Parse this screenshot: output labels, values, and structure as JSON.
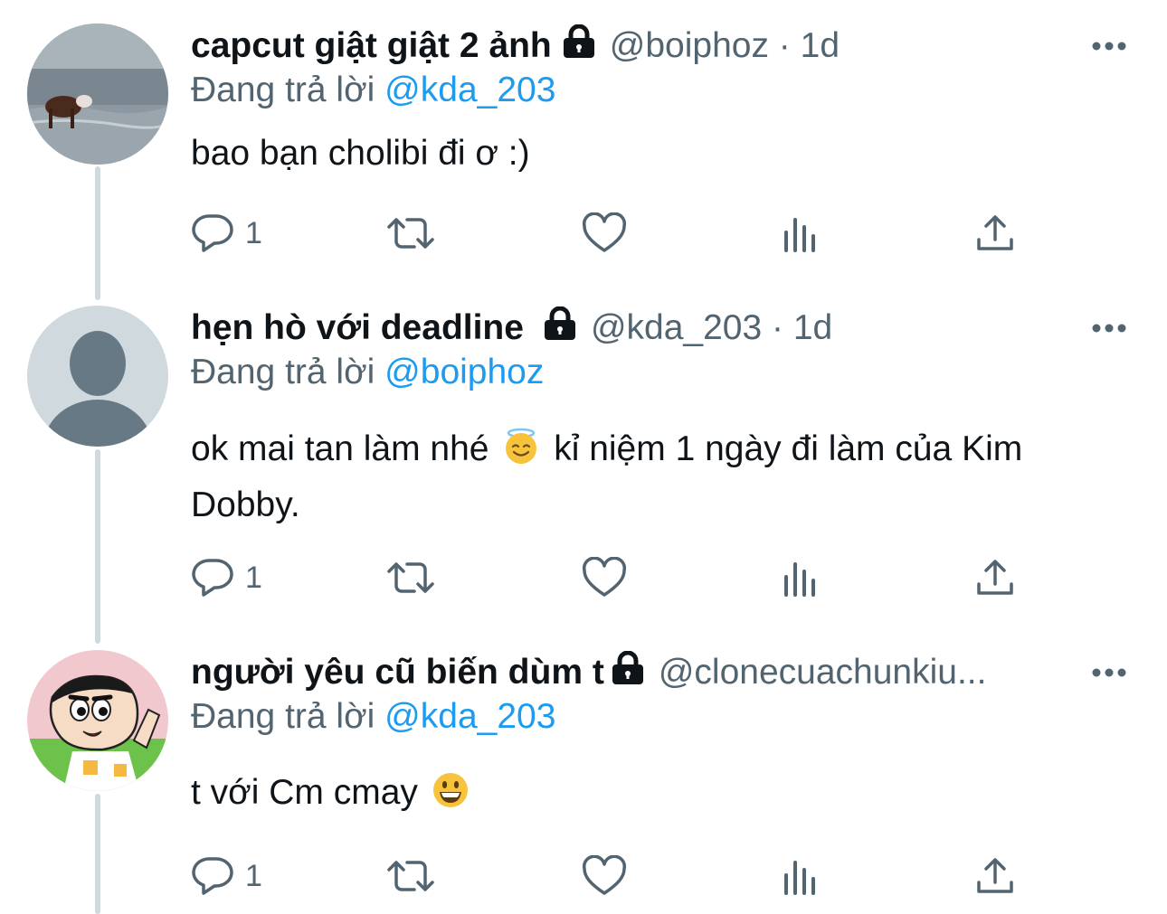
{
  "tweets": [
    {
      "display_name": "capcut giật giật 2 ảnh",
      "handle": "@boiphoz",
      "time": "1d",
      "replying_prefix": "Đang trả lời",
      "replying_to": "@kda_203",
      "text": "bao bạn cholibi đi ơ :)",
      "reply_count": "1",
      "avatar": "cow-on-beach-photo"
    },
    {
      "display_name": "hẹn hò với deadline",
      "handle": "@kda_203",
      "time": "1d",
      "replying_prefix": "Đang trả lời",
      "replying_to": "@boiphoz",
      "text_a": "ok mai tan làm nhé",
      "text_b": "kỉ niệm 1 ngày đi làm của Kim",
      "text_c": "Dobby.",
      "emoji": "smiling-face-with-halo",
      "reply_count": "1",
      "avatar": "default-profile-silhouette"
    },
    {
      "display_name": "người yêu cũ biến dùm t",
      "handle": "@clonecuachunkiu...",
      "replying_prefix": "Đang trả lời",
      "replying_to": "@kda_203",
      "text": "t với Cm cmay",
      "emoji": "grinning-face",
      "reply_count": "1",
      "avatar": "cartoon-boy-avatar"
    }
  ],
  "icons": [
    "lock-icon",
    "more-icon",
    "reply-icon",
    "retweet-icon",
    "like-icon",
    "views-icon",
    "share-icon"
  ],
  "colors": {
    "link": "#1d9bf0",
    "secondary": "#536471",
    "text": "#0f1419",
    "thread_line": "#cfd9de"
  }
}
